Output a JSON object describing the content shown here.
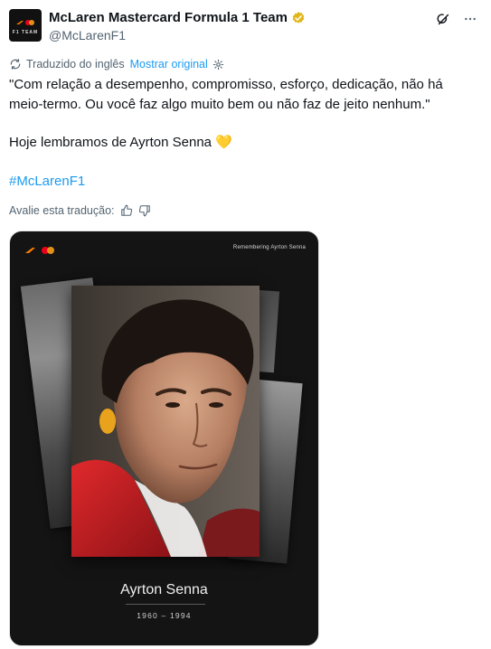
{
  "account": {
    "display_name": "McLaren Mastercard Formula 1 Team",
    "handle": "@McLarenF1",
    "avatar_text": "F1 TEAM",
    "verified": true
  },
  "translation": {
    "label": "Traduzido do inglês",
    "show_original": "Mostrar original",
    "rate_label": "Avalie esta tradução:"
  },
  "tweet": {
    "quote": "\"Com relação a desempenho, compromisso, esforço, dedicação, não há meio-termo. Ou você faz algo muito bem ou não faz de jeito nenhum.\"",
    "line2": "Hoje lembramos de Ayrton Senna 💛",
    "hashtag": "#McLarenF1"
  },
  "media": {
    "caption_top": "Remembering Ayrton Senna",
    "name": "Ayrton Senna",
    "years": "1960 – 1994"
  },
  "icons": {
    "grok": "grok-icon",
    "more": "more-icon",
    "translate": "translate-icon",
    "settings": "settings-icon",
    "thumb_up": "thumb-up-icon",
    "thumb_down": "thumb-down-icon"
  },
  "colors": {
    "accent": "#1d9bf0",
    "text": "#0f1419",
    "muted": "#536471",
    "verified_gold": "#e2b719",
    "papaya": "#ff8000"
  }
}
